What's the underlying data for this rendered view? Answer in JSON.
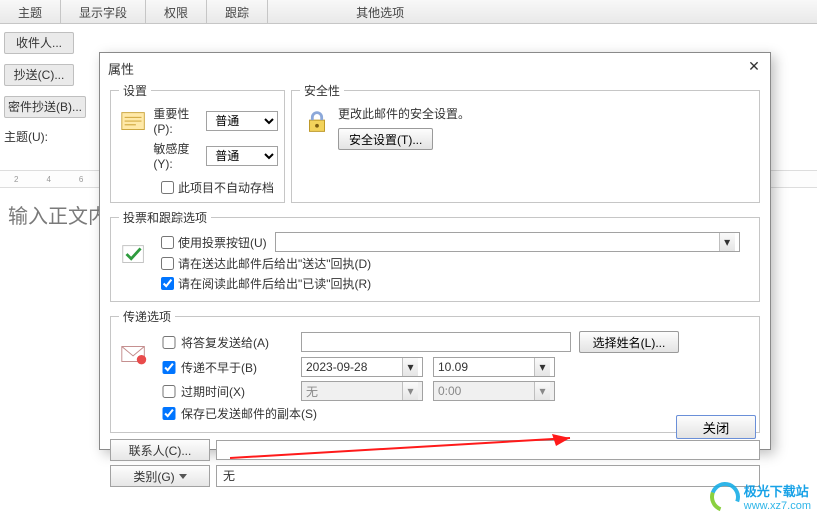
{
  "ribbon": {
    "tabs": [
      "主题",
      "显示字段",
      "权限",
      "跟踪",
      "其他选项"
    ]
  },
  "address": {
    "to": "收件人...",
    "cc": "抄送(C)...",
    "bcc": "密件抄送(B)...",
    "subject_label": "主题(U):"
  },
  "editor": {
    "placeholder": "输入正文内"
  },
  "dialog": {
    "title": "属性",
    "settings_legend": "设置",
    "security_legend": "安全性",
    "importance_label": "重要性(P):",
    "importance_value": "普通",
    "sensitivity_label": "敏感度(Y):",
    "sensitivity_value": "普通",
    "auto_archive_label": "此项目不自动存档",
    "security_desc": "更改此邮件的安全设置。",
    "security_btn": "安全设置(T)...",
    "vote_legend": "投票和跟踪选项",
    "use_vote_label": "使用投票按钮(U)",
    "delivery_receipt_label": "请在送达此邮件后给出\"送达\"回执(D)",
    "read_receipt_label": "请在阅读此邮件后给出\"已读\"回执(R)",
    "delivery_legend": "传递选项",
    "reply_to_label": "将答复发送给(A)",
    "select_contacts_btn": "选择姓名(L)...",
    "not_before_label": "传递不早于(B)",
    "not_before_date": "2023-09-28",
    "not_before_time": "10.09",
    "expire_label": "过期时间(X)",
    "expire_date": "无",
    "expire_time": "0:00",
    "save_copy_label": "保存已发送邮件的副本(S)",
    "contacts_btn": "联系人(C)...",
    "category_btn": "类别(G)",
    "category_value": "无",
    "close_btn": "关闭"
  },
  "watermark": {
    "name": "极光下载站",
    "url": "www.xz7.com"
  }
}
